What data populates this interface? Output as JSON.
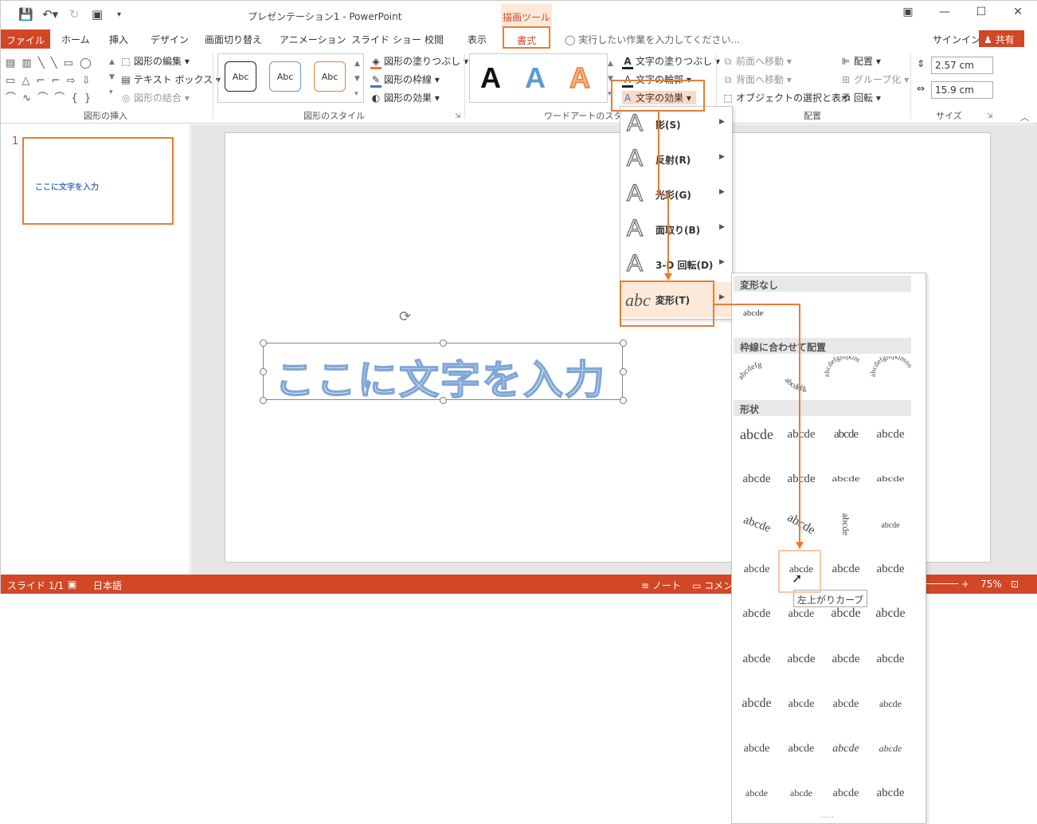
{
  "window": {
    "title": "プレゼンテーション1 - PowerPoint",
    "contextual_tab_group": "描画ツール"
  },
  "tabs": {
    "file": "ファイル",
    "items": [
      "ホーム",
      "挿入",
      "デザイン",
      "画面切り替え",
      "アニメーション",
      "スライド ショー",
      "校閲",
      "表示"
    ],
    "active": "書式",
    "tell_me_placeholder": "実行したい作業を入力してください...",
    "sign_in": "サインイン",
    "share": "共有"
  },
  "ribbon": {
    "insert_shapes": {
      "label": "図形の挿入",
      "edit_shape": "図形の編集",
      "text_box": "テキスト ボックス",
      "merge_shapes": "図形の結合"
    },
    "shape_styles": {
      "label": "図形のスタイル",
      "style_sample": "Abc",
      "fill": "図形の塗りつぶし",
      "outline": "図形の枠線",
      "effects": "図形の効果"
    },
    "wordart_styles": {
      "label": "ワードアートのスタイル",
      "sample": "A",
      "text_fill": "文字の塗りつぶし",
      "text_outline": "文字の輪郭",
      "text_effects": "文字の効果"
    },
    "arrange": {
      "label": "配置",
      "bring_forward": "前面へ移動",
      "send_backward": "背面へ移動",
      "selection_pane": "オブジェクトの選択と表示",
      "align": "配置",
      "group": "グループ化",
      "rotate": "回転"
    },
    "size": {
      "label": "サイズ",
      "height": "2.57 cm",
      "width": "15.9 cm"
    }
  },
  "slide_pane": {
    "slide_number": "1",
    "thumbnail_text": "ここに文字を入力"
  },
  "slide": {
    "textbox_text": "ここに文字を入力"
  },
  "status_bar": {
    "slide_info": "スライド 1/1",
    "language": "日本語",
    "notes": "ノート",
    "comments": "コメント",
    "zoom": "75%"
  },
  "effects_menu": {
    "items": [
      {
        "label": "影(S)",
        "icon": "A"
      },
      {
        "label": "反射(R)",
        "icon": "A"
      },
      {
        "label": "光彩(G)",
        "icon": "A"
      },
      {
        "label": "面取り(B)",
        "icon": "A"
      },
      {
        "label": "3-D 回転(D)",
        "icon": "A"
      },
      {
        "label": "変形(T)",
        "icon": "abc"
      }
    ]
  },
  "transform_gallery": {
    "no_transform_header": "変形なし",
    "no_transform_sample": "abcde",
    "follow_path_header": "枠線に合わせて配置",
    "warp_header": "形状",
    "sample": "abcde",
    "tooltip": "左上がりカーブ",
    "more": "....."
  },
  "accent_color": "#d24726",
  "highlight_color": "#e97c33"
}
